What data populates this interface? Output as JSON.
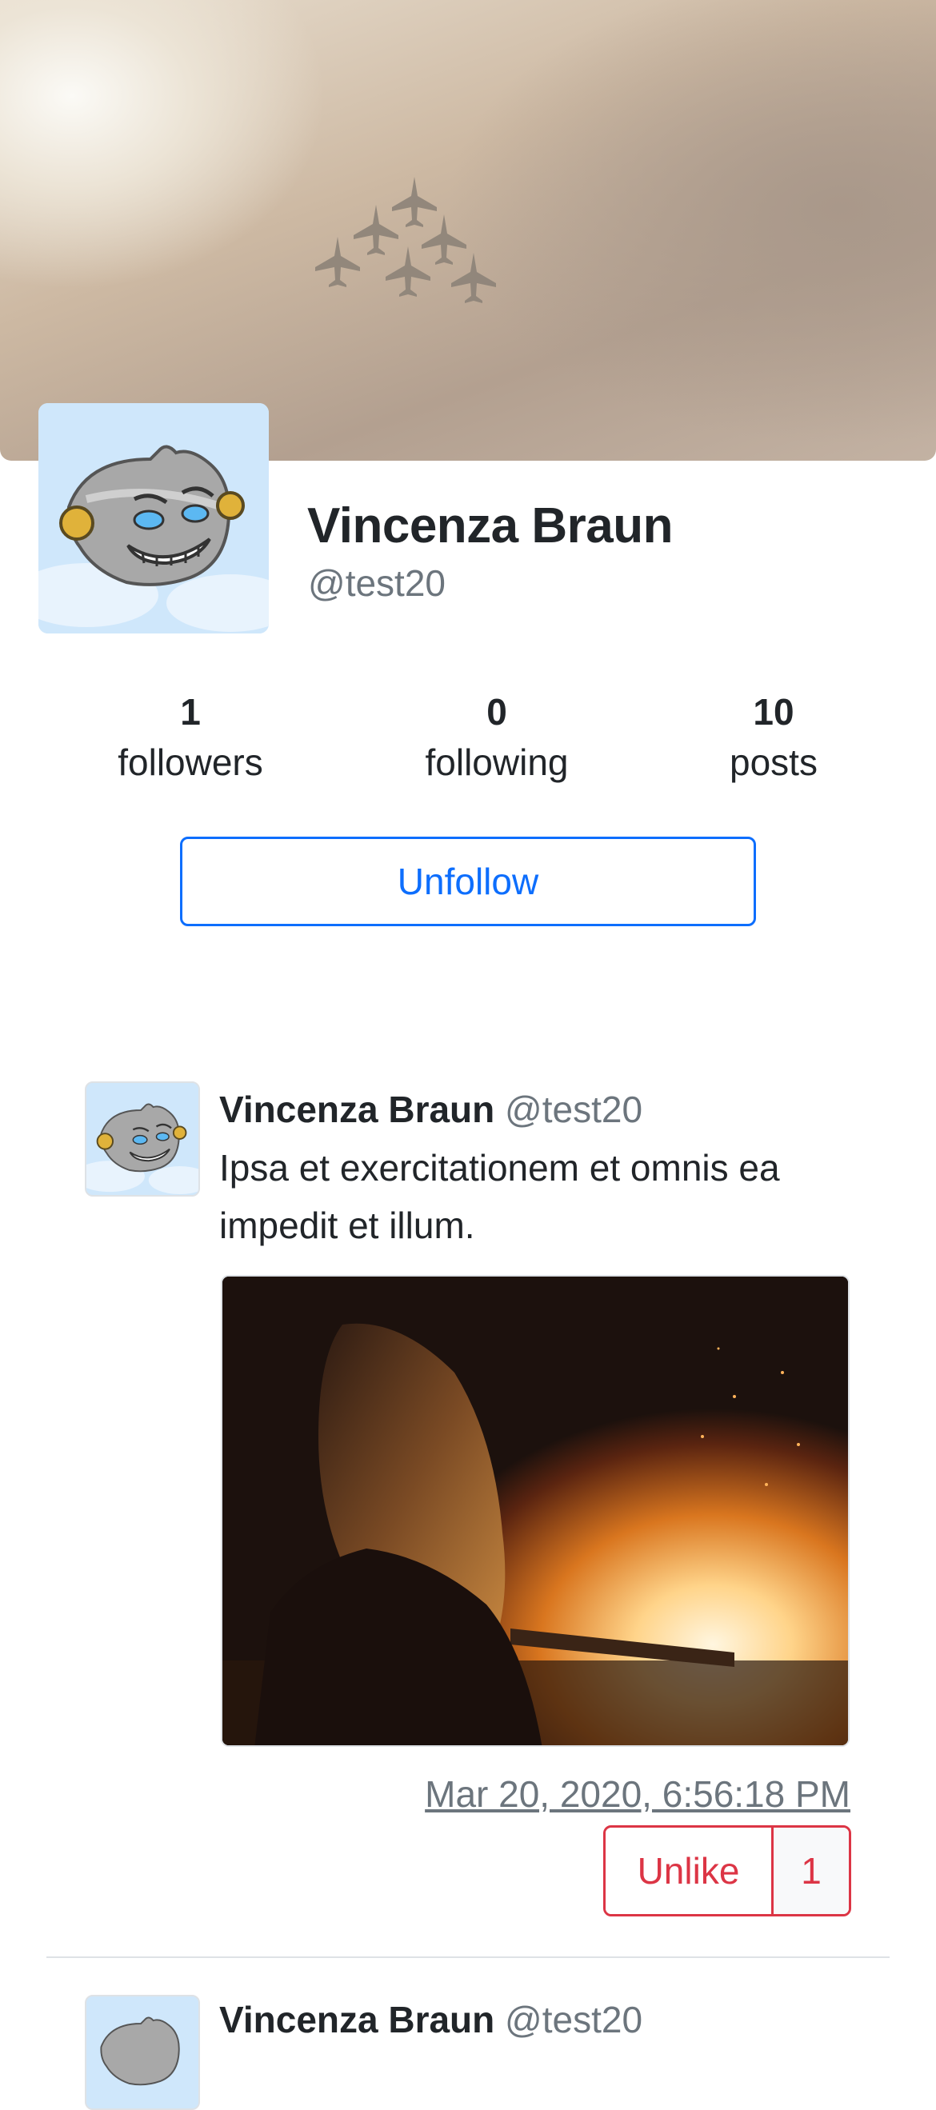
{
  "profile": {
    "name": "Vincenza Braun",
    "handle": "@test20",
    "avatar_icon": "robot-avatar-icon"
  },
  "stats": [
    {
      "value": "1",
      "label": "followers"
    },
    {
      "value": "0",
      "label": "following"
    },
    {
      "value": "10",
      "label": "posts"
    }
  ],
  "follow_button": {
    "label": "Unfollow",
    "color": "#0d6efd"
  },
  "posts": [
    {
      "author_name": "Vincenza Braun",
      "author_handle": "@test20",
      "text": "Ipsa et exercitationem et omnis ea impedit et illum.",
      "date": "Mar 20, 2020, 6:56:18 PM",
      "like_label": "Unlike",
      "like_count": "1"
    },
    {
      "author_name": "Vincenza Braun",
      "author_handle": "@test20"
    }
  ],
  "colors": {
    "danger": "#dc3545",
    "muted": "#6c757d",
    "primary": "#0d6efd"
  }
}
